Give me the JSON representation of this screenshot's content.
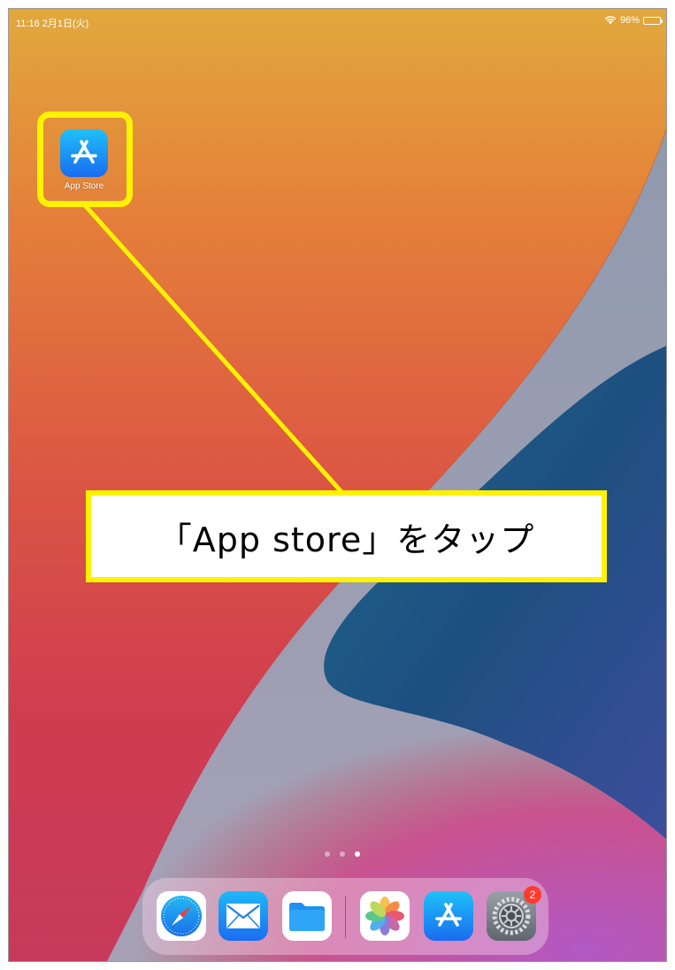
{
  "status_bar": {
    "time_date": "11:16  2月1日(火)",
    "battery": "96%",
    "battery_level": 0.96,
    "wifi_icon": "wifi-icon"
  },
  "home": {
    "apps": [
      {
        "label": "App Store",
        "icon": "app-store-icon"
      }
    ],
    "page_dots": {
      "count": 3,
      "active_index": 2
    }
  },
  "annotation": {
    "callout_text": "「App store」をタップ",
    "highlight_color": "#fff200"
  },
  "dock": {
    "items": [
      {
        "icon": "safari-icon"
      },
      {
        "icon": "mail-icon"
      },
      {
        "icon": "files-icon"
      },
      {
        "icon": "photos-icon"
      },
      {
        "icon": "app-store-icon"
      },
      {
        "icon": "settings-icon",
        "badge": "2"
      }
    ]
  },
  "colors": {
    "wallpaper_orange": "#e8a23a",
    "wallpaper_red": "#d8404a",
    "wallpaper_blue": "#1f5a86",
    "wallpaper_purple": "#b055b4",
    "badge_red": "#ff3b30"
  }
}
